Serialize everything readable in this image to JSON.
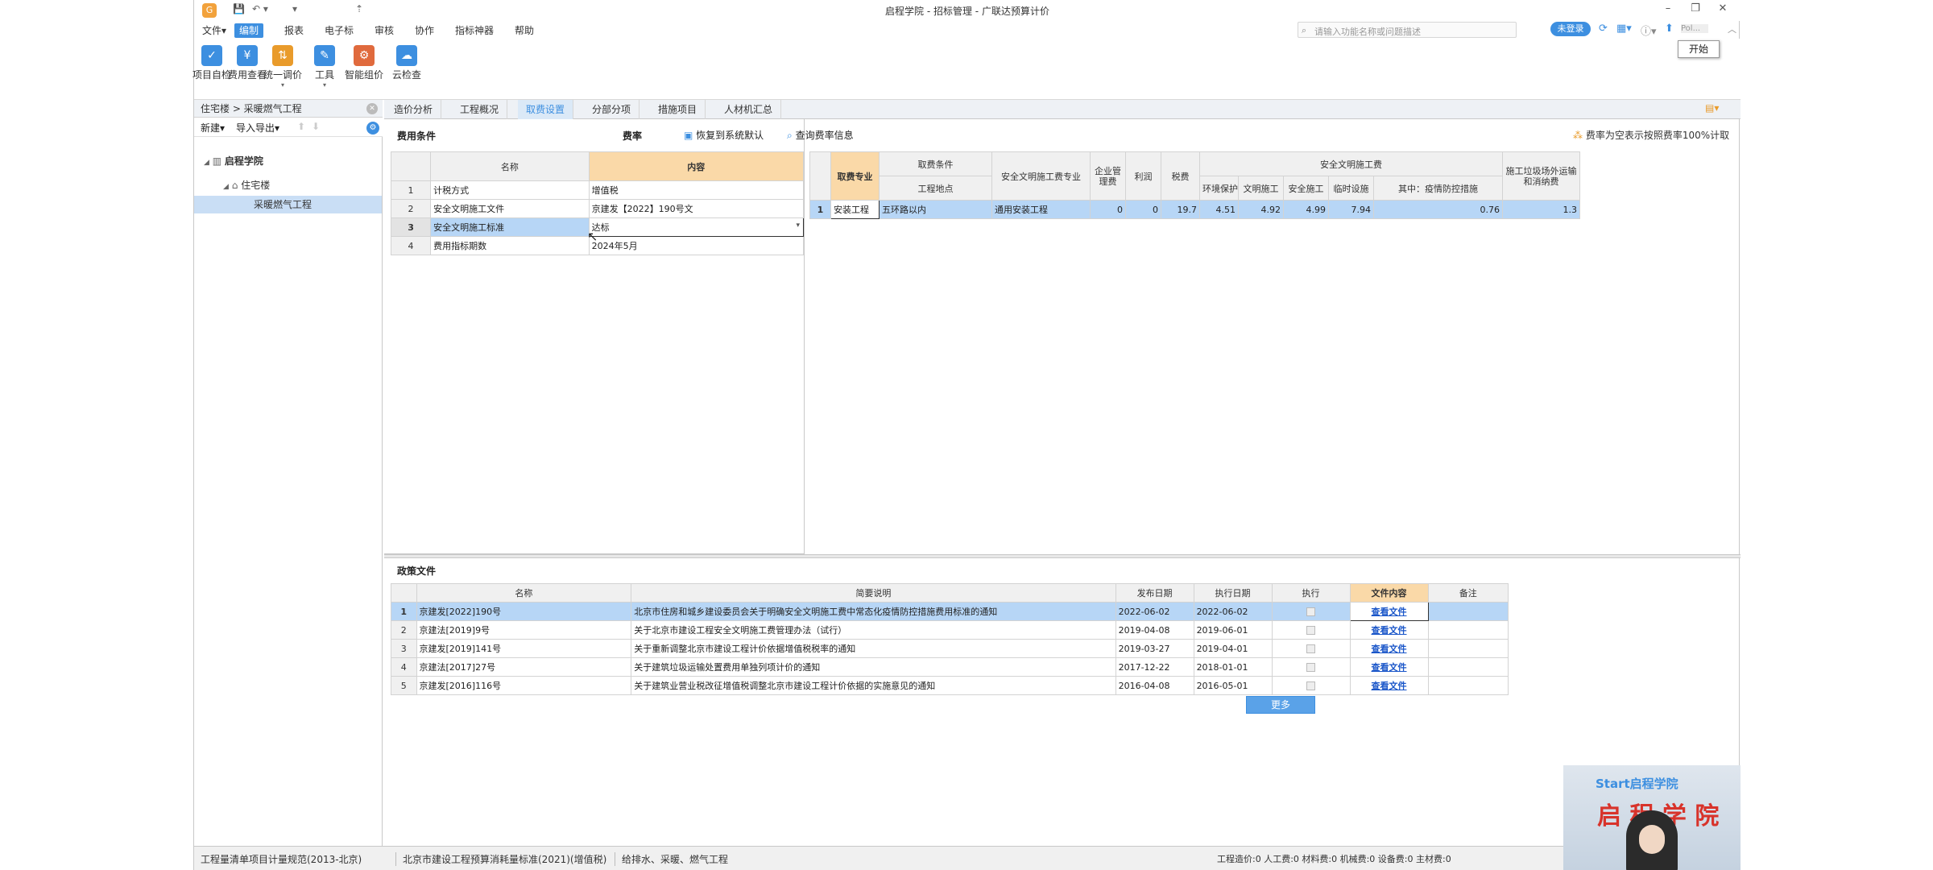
{
  "app": {
    "title": "启程学院 - 招标管理 - 广联达预算计价",
    "logo": "G"
  },
  "quick_access": [
    "💾",
    "↶ ▾",
    "▾",
    "⇡"
  ],
  "menu": [
    "文件▾",
    "编制",
    "报表",
    "电子标",
    "审核",
    "协作",
    "指标神器",
    "帮助"
  ],
  "menu_active_index": 1,
  "search": {
    "placeholder": "请输入功能名称或问题描述"
  },
  "login_label": "未登录",
  "tooltip": "开始",
  "user_short": "Pol...",
  "ribbon": [
    {
      "label": "项目自检",
      "icon": "check-icon",
      "color": "#3d8fe0"
    },
    {
      "label": "费用查看",
      "icon": "fee-view-icon",
      "color": "#3d8fe0"
    },
    {
      "label": "统一调价",
      "icon": "price-adjust-icon",
      "color": "#e99b2b"
    },
    {
      "label": "工具",
      "icon": "tool-icon",
      "color": "#3d8fe0"
    },
    {
      "label": "智能组价",
      "icon": "smart-price-icon",
      "color": "#e06a3d"
    },
    {
      "label": "云检查",
      "icon": "cloud-check-icon",
      "color": "#3d8fe0"
    }
  ],
  "breadcrumb": "住宅楼 > 采暖燃气工程",
  "left_tools": {
    "new": "新建▾",
    "import_export": "导入导出▾"
  },
  "tree": [
    {
      "label": "启程学院",
      "level": 0,
      "expanded": true
    },
    {
      "label": "住宅楼",
      "level": 1,
      "expanded": true
    },
    {
      "label": "采暖燃气工程",
      "level": 2,
      "selected": true
    }
  ],
  "tabs": [
    "造价分析",
    "工程概况",
    "取费设置",
    "分部分项",
    "措施项目",
    "人材机汇总"
  ],
  "active_tab": 2,
  "fee_conditions": {
    "title": "费用条件",
    "headers": [
      "名称",
      "内容"
    ],
    "rows": [
      {
        "no": "1",
        "name": "计税方式",
        "value": "增值税"
      },
      {
        "no": "2",
        "name": "安全文明施工文件",
        "value": "京建发【2022】190号文"
      },
      {
        "no": "3",
        "name": "安全文明施工标准",
        "value": "达标"
      },
      {
        "no": "4",
        "name": "费用指标期数",
        "value": "2024年5月"
      }
    ],
    "selected_row": 2
  },
  "rates": {
    "title": "费率",
    "restore_label": "恢复到系统默认",
    "query_label": "查询费率信息",
    "note": "费率为空表示按照费率100%计取",
    "headers": {
      "major": "取费专业",
      "condition": "取费条件",
      "location": "工程地点",
      "safety_major": "安全文明施工费专业",
      "mgmt": "企业管理费",
      "profit": "利润",
      "tax": "税费",
      "safety_group": "安全文明施工费",
      "env": "环境保护",
      "civil": "文明施工",
      "safety": "安全施工",
      "temp": "临时设施",
      "epidemic": "其中：疫情防控措施",
      "waste": "施工垃圾场外运输和消纳费"
    },
    "row": {
      "no": "1",
      "major": "安装工程",
      "location": "五环路以内",
      "safety_major": "通用安装工程",
      "mgmt": "0",
      "profit": "0",
      "tax": "19.7",
      "env": "4.51",
      "civil": "4.92",
      "safety": "4.99",
      "temp": "7.94",
      "epidemic": "0.76",
      "waste": "1.3"
    }
  },
  "policy": {
    "title": "政策文件",
    "headers": [
      "名称",
      "简要说明",
      "发布日期",
      "执行日期",
      "执行",
      "文件内容",
      "备注"
    ],
    "link_label": "查看文件",
    "more_label": "更多",
    "rows": [
      {
        "no": "1",
        "name": "京建发[2022]190号",
        "desc": "北京市住房和城乡建设委员会关于明确安全文明施工费中常态化疫情防控措施费用标准的通知",
        "pub": "2022-06-02",
        "exec": "2022-06-02"
      },
      {
        "no": "2",
        "name": "京建法[2019]9号",
        "desc": "关于北京市建设工程安全文明施工费管理办法（试行）",
        "pub": "2019-04-08",
        "exec": "2019-06-01"
      },
      {
        "no": "3",
        "name": "京建发[2019]141号",
        "desc": "关于重新调整北京市建设工程计价依据增值税税率的通知",
        "pub": "2019-03-27",
        "exec": "2019-04-01"
      },
      {
        "no": "4",
        "name": "京建法[2017]27号",
        "desc": "关于建筑垃圾运输处置费用单独列项计价的通知",
        "pub": "2017-12-22",
        "exec": "2018-01-01"
      },
      {
        "no": "5",
        "name": "京建发[2016]116号",
        "desc": "关于建筑业营业税改征增值税调整北京市建设工程计价依据的实施意见的通知",
        "pub": "2016-04-08",
        "exec": "2016-05-01"
      }
    ]
  },
  "status": {
    "norm": "工程量清单项目计量规范(2013-北京)",
    "quota": "北京市建设工程预算消耗量标准(2021)(增值税)",
    "major": "给排水、采暖、燃气工程",
    "totals": "工程造价:0  人工费:0  材料费:0  机械费:0  设备费:0  主材费:0"
  },
  "video": {
    "brand": "Start启程学院",
    "caption": "启 程 学 院"
  }
}
